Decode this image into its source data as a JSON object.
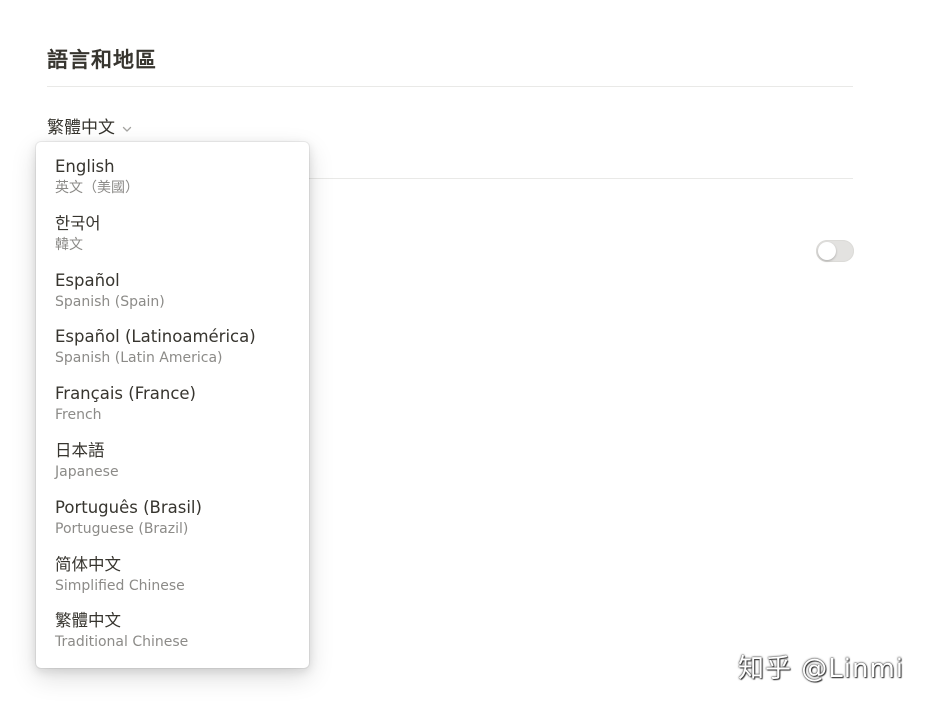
{
  "section": {
    "title": "語言和地區"
  },
  "language_select": {
    "current": "繁體中文",
    "chevron_icon": "chevron-down-icon"
  },
  "dropdown": {
    "options": [
      {
        "label": "English",
        "sublabel": "英文（美國）"
      },
      {
        "label": "한국어",
        "sublabel": "韓文"
      },
      {
        "label": "Español",
        "sublabel": "Spanish (Spain)"
      },
      {
        "label": "Español (Latinoamérica)",
        "sublabel": "Spanish (Latin America)"
      },
      {
        "label": "Français (France)",
        "sublabel": "French"
      },
      {
        "label": "日本語",
        "sublabel": "Japanese"
      },
      {
        "label": "Português (Brasil)",
        "sublabel": "Portuguese (Brazil)"
      },
      {
        "label": "简体中文",
        "sublabel": "Simplified Chinese"
      },
      {
        "label": "繁體中文",
        "sublabel": "Traditional Chinese"
      }
    ]
  },
  "toggle": {
    "state": "off"
  },
  "watermark": {
    "text": "知乎 @Linmi"
  },
  "colors": {
    "text_primary": "#37352f",
    "text_secondary": "#8c8b88",
    "divider": "#e9e9e7",
    "toggle_off": "#e3e2e0"
  }
}
